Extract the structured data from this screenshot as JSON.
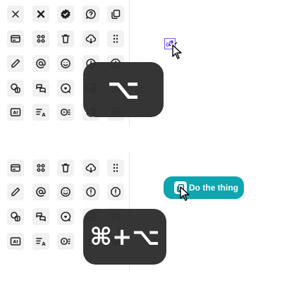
{
  "shortcuts": {
    "top": "⌥",
    "bottom": "⌘+⌥"
  },
  "action_pill": {
    "label": "Do the thing"
  },
  "colors": {
    "accent": "#0ea5b0",
    "selection": "#7b5cf0",
    "overlay": "#2f2f2f",
    "tile": "#f1f1f1"
  },
  "icon_grid_top": [
    [
      "close-thin-icon",
      "close-bold-icon",
      "verified-badge-icon",
      "help-bubble-icon",
      "copy-icon"
    ],
    [
      "card-icon",
      "apps-grid-icon",
      "trash-icon",
      "cloud-download-icon",
      "drag-dots-icon"
    ],
    [
      "pencil-icon",
      "at-sign-icon",
      "smile-icon",
      "alert-circle-icon",
      "alert-octagon-icon"
    ],
    [
      "currency-exchange-icon",
      "chat-bubbles-icon",
      "chat-heart-icon",
      "image-gallery-icon",
      "list-sort-icon"
    ],
    [
      "ai-badge-icon",
      "text-sort-icon",
      "video-playlist-icon",
      "brand-outline-icon",
      "brand-shield-icon"
    ]
  ],
  "icon_grid_bottom": [
    [
      "card-icon",
      "apps-grid-icon",
      "trash-icon",
      "cloud-download-icon",
      "drag-dots-icon"
    ],
    [
      "pencil-icon",
      "at-sign-icon",
      "smile-icon",
      "alert-circle-icon",
      "alert-octagon-icon"
    ],
    [
      "currency-exchange-icon",
      "chat-bubbles-icon",
      "chat-heart-icon",
      "image-gallery-icon",
      "list-sort-icon"
    ],
    [
      "ai-badge-icon",
      "text-sort-icon",
      "video-playlist-icon",
      "brand-outline-icon",
      "brand-shield-icon"
    ]
  ]
}
